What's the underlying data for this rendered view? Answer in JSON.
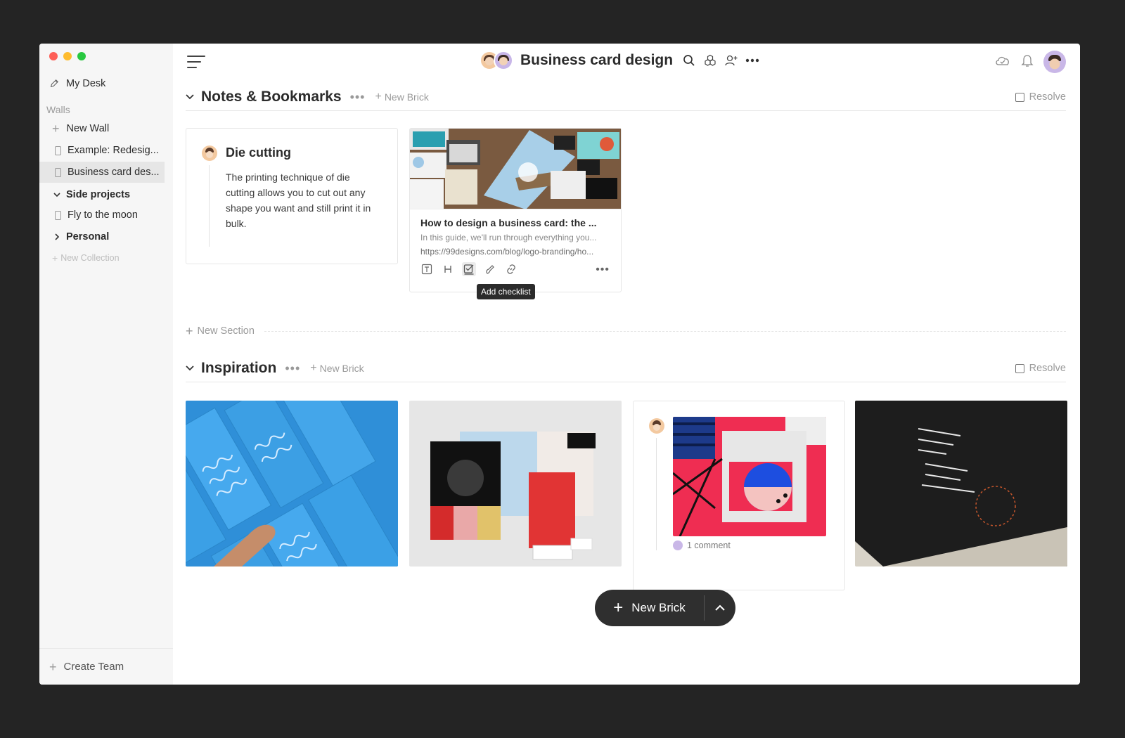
{
  "sidebar": {
    "my_desk": "My Desk",
    "walls_heading": "Walls",
    "new_wall": "New Wall",
    "walls": [
      "Example: Redesig...",
      "Business card des..."
    ],
    "collections": [
      {
        "label": "Side projects",
        "expanded": true,
        "items": [
          "Fly to the moon"
        ]
      },
      {
        "label": "Personal",
        "expanded": false,
        "items": []
      }
    ],
    "new_collection": "New Collection",
    "create_team": "Create Team"
  },
  "header": {
    "title": "Business card design",
    "icons": [
      "search-icon",
      "cubes-icon",
      "add-user-icon",
      "more-icon"
    ],
    "right_icons": [
      "cloud-icon",
      "bell-icon",
      "user-avatar"
    ]
  },
  "sections": [
    {
      "title": "Notes & Bookmarks",
      "new_brick": "New Brick",
      "resolve": "Resolve",
      "note": {
        "title": "Die cutting",
        "body": "The printing technique of die cutting allows you to cut out any shape you want and still print it in bulk."
      },
      "bookmark": {
        "title": "How to design a business card: the ...",
        "description": "In this guide, we'll run through everything you...",
        "url": "https://99designs.com/blog/logo-branding/ho...",
        "tools": [
          "T",
          "H",
          "checklist-icon",
          "draw-icon",
          "link-icon"
        ],
        "tooltip": "Add checklist"
      }
    },
    {
      "title": "Inspiration",
      "new_brick": "New Brick",
      "resolve": "Resolve",
      "comment": "1 comment"
    }
  ],
  "new_section": "New Section",
  "fab": {
    "label": "New Brick"
  },
  "colors": {
    "accent_red": "#fe5f57",
    "accent_yellow": "#febc2e",
    "accent_green": "#28c840",
    "fab_bg": "#2f2f2f"
  }
}
